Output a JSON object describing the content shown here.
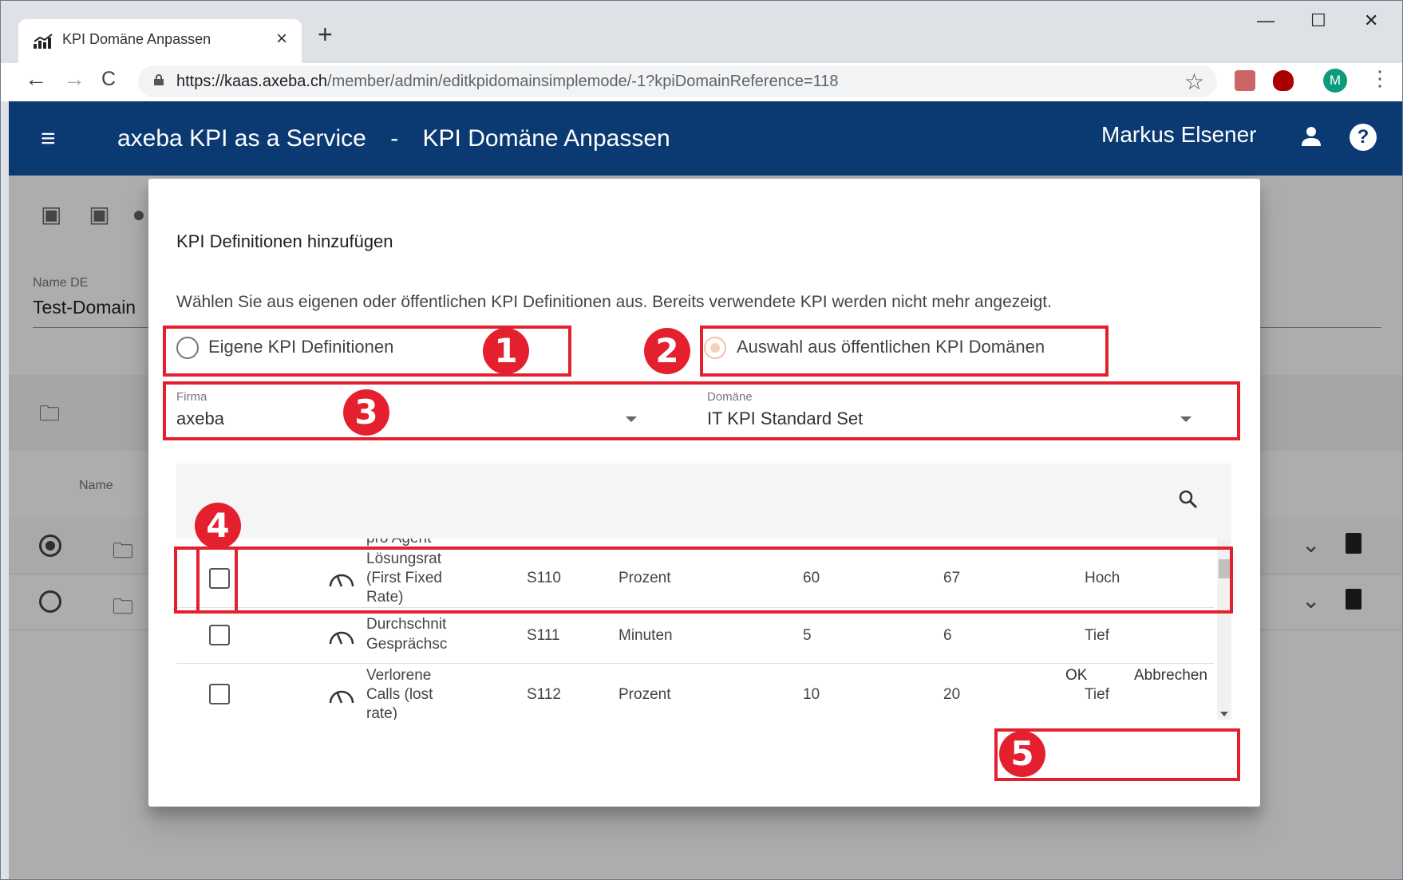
{
  "browser": {
    "tab_title": "KPI Domäne Anpassen",
    "tab_close": "×",
    "new_tab": "+",
    "minimize": "—",
    "maximize": "☐",
    "close": "✕",
    "back": "←",
    "forward": "→",
    "reload": "C",
    "url_host": "https://kaas.axeba.ch",
    "url_path": "/member/admin/editkpidomainsimplemode/-1?kpiDomainReference=118",
    "star": "☆",
    "avatar_letter": "M",
    "menu": "⋮"
  },
  "app": {
    "hamburger": "≡",
    "title": "axeba KPI as a Service",
    "separator": "-",
    "page_title": "KPI Domäne Anpassen",
    "user": "Markus Elsener",
    "help": "?"
  },
  "background": {
    "name_label": "Name DE",
    "name_value": "Test-Domain",
    "column_name": "Name"
  },
  "dialog": {
    "title": "KPI Definitionen hinzufügen",
    "description": "Wählen Sie aus eigenen oder öffentlichen KPI Definitionen aus. Bereits verwendete KPI werden nicht mehr angezeigt.",
    "radio_own": "Eigene KPI Definitionen",
    "radio_public": "Auswahl aus öffentlichen KPI Domänen",
    "company_label": "Firma",
    "company_value": "axeba",
    "domain_label": "Domäne",
    "domain_value": "IT KPI Standard Set",
    "partial_row_text": "pro Agent",
    "rows": [
      {
        "name_lines": [
          "Lösungsrat",
          "(First Fixed",
          "Rate)"
        ],
        "code": "S110",
        "unit": "Prozent",
        "target": "60",
        "limit": "67",
        "direction": "Hoch"
      },
      {
        "name_lines": [
          "Durchschnit",
          "Gesprächsc"
        ],
        "code": "S111",
        "unit": "Minuten",
        "target": "5",
        "limit": "6",
        "direction": "Tief"
      },
      {
        "name_lines": [
          "Verlorene",
          "Calls (lost",
          "rate)"
        ],
        "code": "S112",
        "unit": "Prozent",
        "target": "10",
        "limit": "20",
        "direction": "Tief"
      }
    ],
    "ok": "OK",
    "cancel": "Abbrechen"
  },
  "annotations": [
    "1",
    "2",
    "3",
    "4",
    "5"
  ],
  "colors": {
    "header": "#0b3a73",
    "annotation": "#e4202f"
  }
}
